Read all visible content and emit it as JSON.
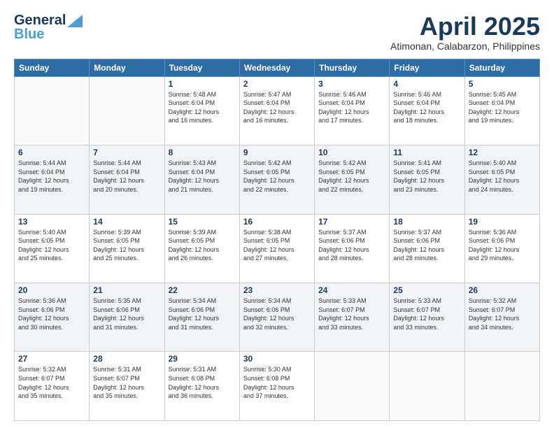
{
  "header": {
    "logo_line1": "General",
    "logo_line2": "Blue",
    "title": "April 2025",
    "subtitle": "Atimonan, Calabarzon, Philippines"
  },
  "columns": [
    "Sunday",
    "Monday",
    "Tuesday",
    "Wednesday",
    "Thursday",
    "Friday",
    "Saturday"
  ],
  "weeks": [
    {
      "days": [
        {
          "num": "",
          "info": ""
        },
        {
          "num": "",
          "info": ""
        },
        {
          "num": "1",
          "info": "Sunrise: 5:48 AM\nSunset: 6:04 PM\nDaylight: 12 hours\nand 16 minutes."
        },
        {
          "num": "2",
          "info": "Sunrise: 5:47 AM\nSunset: 6:04 PM\nDaylight: 12 hours\nand 16 minutes."
        },
        {
          "num": "3",
          "info": "Sunrise: 5:46 AM\nSunset: 6:04 PM\nDaylight: 12 hours\nand 17 minutes."
        },
        {
          "num": "4",
          "info": "Sunrise: 5:46 AM\nSunset: 6:04 PM\nDaylight: 12 hours\nand 18 minutes."
        },
        {
          "num": "5",
          "info": "Sunrise: 5:45 AM\nSunset: 6:04 PM\nDaylight: 12 hours\nand 19 minutes."
        }
      ]
    },
    {
      "days": [
        {
          "num": "6",
          "info": "Sunrise: 5:44 AM\nSunset: 6:04 PM\nDaylight: 12 hours\nand 19 minutes."
        },
        {
          "num": "7",
          "info": "Sunrise: 5:44 AM\nSunset: 6:04 PM\nDaylight: 12 hours\nand 20 minutes."
        },
        {
          "num": "8",
          "info": "Sunrise: 5:43 AM\nSunset: 6:04 PM\nDaylight: 12 hours\nand 21 minutes."
        },
        {
          "num": "9",
          "info": "Sunrise: 5:42 AM\nSunset: 6:05 PM\nDaylight: 12 hours\nand 22 minutes."
        },
        {
          "num": "10",
          "info": "Sunrise: 5:42 AM\nSunset: 6:05 PM\nDaylight: 12 hours\nand 22 minutes."
        },
        {
          "num": "11",
          "info": "Sunrise: 5:41 AM\nSunset: 6:05 PM\nDaylight: 12 hours\nand 23 minutes."
        },
        {
          "num": "12",
          "info": "Sunrise: 5:40 AM\nSunset: 6:05 PM\nDaylight: 12 hours\nand 24 minutes."
        }
      ]
    },
    {
      "days": [
        {
          "num": "13",
          "info": "Sunrise: 5:40 AM\nSunset: 6:05 PM\nDaylight: 12 hours\nand 25 minutes."
        },
        {
          "num": "14",
          "info": "Sunrise: 5:39 AM\nSunset: 6:05 PM\nDaylight: 12 hours\nand 25 minutes."
        },
        {
          "num": "15",
          "info": "Sunrise: 5:39 AM\nSunset: 6:05 PM\nDaylight: 12 hours\nand 26 minutes."
        },
        {
          "num": "16",
          "info": "Sunrise: 5:38 AM\nSunset: 6:05 PM\nDaylight: 12 hours\nand 27 minutes."
        },
        {
          "num": "17",
          "info": "Sunrise: 5:37 AM\nSunset: 6:06 PM\nDaylight: 12 hours\nand 28 minutes."
        },
        {
          "num": "18",
          "info": "Sunrise: 5:37 AM\nSunset: 6:06 PM\nDaylight: 12 hours\nand 28 minutes."
        },
        {
          "num": "19",
          "info": "Sunrise: 5:36 AM\nSunset: 6:06 PM\nDaylight: 12 hours\nand 29 minutes."
        }
      ]
    },
    {
      "days": [
        {
          "num": "20",
          "info": "Sunrise: 5:36 AM\nSunset: 6:06 PM\nDaylight: 12 hours\nand 30 minutes."
        },
        {
          "num": "21",
          "info": "Sunrise: 5:35 AM\nSunset: 6:06 PM\nDaylight: 12 hours\nand 31 minutes."
        },
        {
          "num": "22",
          "info": "Sunrise: 5:34 AM\nSunset: 6:06 PM\nDaylight: 12 hours\nand 31 minutes."
        },
        {
          "num": "23",
          "info": "Sunrise: 5:34 AM\nSunset: 6:06 PM\nDaylight: 12 hours\nand 32 minutes."
        },
        {
          "num": "24",
          "info": "Sunrise: 5:33 AM\nSunset: 6:07 PM\nDaylight: 12 hours\nand 33 minutes."
        },
        {
          "num": "25",
          "info": "Sunrise: 5:33 AM\nSunset: 6:07 PM\nDaylight: 12 hours\nand 33 minutes."
        },
        {
          "num": "26",
          "info": "Sunrise: 5:32 AM\nSunset: 6:07 PM\nDaylight: 12 hours\nand 34 minutes."
        }
      ]
    },
    {
      "days": [
        {
          "num": "27",
          "info": "Sunrise: 5:32 AM\nSunset: 6:07 PM\nDaylight: 12 hours\nand 35 minutes."
        },
        {
          "num": "28",
          "info": "Sunrise: 5:31 AM\nSunset: 6:07 PM\nDaylight: 12 hours\nand 35 minutes."
        },
        {
          "num": "29",
          "info": "Sunrise: 5:31 AM\nSunset: 6:08 PM\nDaylight: 12 hours\nand 36 minutes."
        },
        {
          "num": "30",
          "info": "Sunrise: 5:30 AM\nSunset: 6:08 PM\nDaylight: 12 hours\nand 37 minutes."
        },
        {
          "num": "",
          "info": ""
        },
        {
          "num": "",
          "info": ""
        },
        {
          "num": "",
          "info": ""
        }
      ]
    }
  ]
}
